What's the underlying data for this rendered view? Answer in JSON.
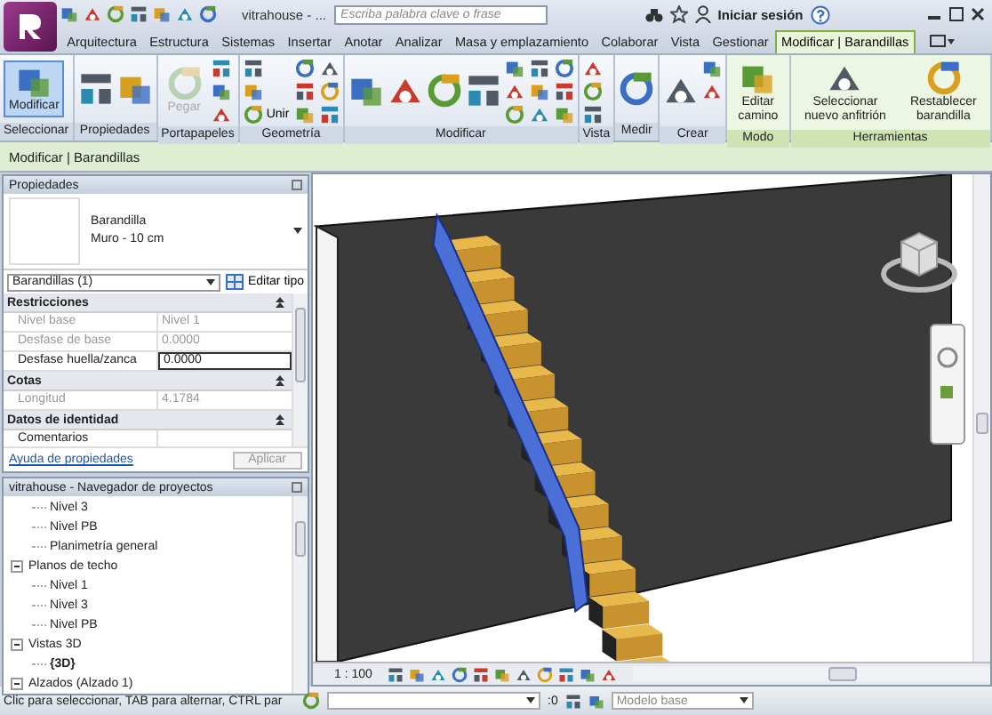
{
  "title_bar": {
    "title": "vitrahouse - ...",
    "search": {
      "placeholder": "Escriba palabra clave o frase"
    },
    "sign_in": "Iniciar sesión"
  },
  "tabs": [
    {
      "label": "Arquitectura",
      "selected": false
    },
    {
      "label": "Estructura",
      "selected": false
    },
    {
      "label": "Sistemas",
      "selected": false
    },
    {
      "label": "Insertar",
      "selected": false
    },
    {
      "label": "Anotar",
      "selected": false
    },
    {
      "label": "Analizar",
      "selected": false
    },
    {
      "label": "Masa y emplazamiento",
      "selected": false
    },
    {
      "label": "Colaborar",
      "selected": false
    },
    {
      "label": "Vista",
      "selected": false
    },
    {
      "label": "Gestionar",
      "selected": false
    },
    {
      "label": "Modificar | Barandillas",
      "selected": true
    }
  ],
  "ribbon": {
    "panels": [
      {
        "label": "Seleccionar",
        "tools": [
          {
            "kind": "large",
            "label": "Modificar",
            "active": true,
            "disabled": false
          }
        ]
      },
      {
        "label": "Propiedades",
        "tools": [
          {
            "kind": "large_icon"
          },
          {
            "kind": "large_icon"
          }
        ]
      },
      {
        "label": "Portapapeles",
        "tools": [
          {
            "kind": "large",
            "label": "Pegar",
            "active": false,
            "disabled": true
          },
          {
            "kind": "icon"
          },
          {
            "kind": "icon"
          },
          {
            "kind": "icon"
          }
        ]
      },
      {
        "label": "Geometría",
        "tools": [
          {
            "kind": "icon"
          },
          {
            "kind": "icon"
          },
          {
            "kind": "small",
            "label": "Unir"
          },
          {
            "kind": "icon"
          },
          {
            "kind": "icon"
          },
          {
            "kind": "icon"
          },
          {
            "kind": "icon"
          },
          {
            "kind": "icon"
          },
          {
            "kind": "icon"
          }
        ]
      },
      {
        "label": "Modificar",
        "tools": [
          {
            "kind": "large_icon"
          },
          {
            "kind": "large_icon"
          },
          {
            "kind": "large_icon"
          },
          {
            "kind": "large_icon"
          },
          {
            "kind": "icon"
          },
          {
            "kind": "icon"
          },
          {
            "kind": "icon"
          },
          {
            "kind": "icon"
          },
          {
            "kind": "icon"
          },
          {
            "kind": "icon"
          },
          {
            "kind": "icon"
          },
          {
            "kind": "icon"
          },
          {
            "kind": "icon"
          }
        ]
      },
      {
        "label": "Vista",
        "tools": [
          {
            "kind": "icon"
          },
          {
            "kind": "icon"
          },
          {
            "kind": "icon"
          }
        ]
      },
      {
        "label": "Medir",
        "tools": [
          {
            "kind": "large_icon"
          }
        ]
      },
      {
        "label": "Crear",
        "tools": [
          {
            "kind": "large_icon"
          },
          {
            "kind": "icon"
          },
          {
            "kind": "icon"
          }
        ]
      },
      {
        "label": "Modo",
        "tools": [
          {
            "kind": "large",
            "label": "Editar camino",
            "active": false,
            "disabled": false
          }
        ]
      },
      {
        "label": "Herramientas",
        "tools": [
          {
            "kind": "large",
            "label": "Seleccionar nuevo anfitrión",
            "active": false,
            "disabled": false
          },
          {
            "kind": "large",
            "label": "Restablecer barandilla",
            "active": false,
            "disabled": false
          }
        ]
      }
    ]
  },
  "options_bar": {
    "text": "Modificar | Barandillas"
  },
  "properties": {
    "title": "Propiedades",
    "type_name": "Barandilla",
    "type_detail": "Muro - 10 cm",
    "selector": "Barandillas (1)",
    "edit_type": "Editar tipo",
    "groups": [
      {
        "label": "Restricciones",
        "rows": [
          {
            "name": "Nivel base",
            "value": "Nivel 1",
            "disabled": true,
            "editing": false
          },
          {
            "name": "Desfase de base",
            "value": "0.0000",
            "disabled": true,
            "editing": false
          },
          {
            "name": "Desfase huella/zanca",
            "value": "0.0000",
            "disabled": false,
            "editing": true
          }
        ]
      },
      {
        "label": "Cotas",
        "rows": [
          {
            "name": "Longitud",
            "value": "4.1784",
            "disabled": true,
            "editing": false
          }
        ]
      },
      {
        "label": "Datos de identidad",
        "rows": [
          {
            "name": "Comentarios",
            "disabled": false,
            "editing": false
          }
        ]
      }
    ],
    "help_link": "Ayuda de propiedades",
    "apply": "Aplicar"
  },
  "browser": {
    "title": "vitrahouse - Navegador de proyectos",
    "tree": [
      {
        "children": [
          {
            "label": "Nivel 3",
            "selected": false
          },
          {
            "label": "Nivel PB",
            "selected": false
          },
          {
            "label": "Planimetría general",
            "selected": false
          }
        ]
      },
      {
        "label": "Planos de techo",
        "expanded": true,
        "selected": false,
        "children": [
          {
            "label": "Nivel 1",
            "selected": false
          },
          {
            "label": "Nivel 3",
            "selected": false
          },
          {
            "label": "Nivel PB",
            "selected": false
          }
        ]
      },
      {
        "label": "Vistas 3D",
        "expanded": true,
        "selected": false,
        "children": [
          {
            "label": "{3D}",
            "selected": true
          }
        ]
      },
      {
        "label": "Alzados (Alzado 1)",
        "expanded": true,
        "selected": false
      }
    ]
  },
  "view_bar": {
    "scale": "1 : 100"
  },
  "status_bar": {
    "text": "Clic para seleccionar, TAB para alternar, CTRL par",
    "filter": ":0",
    "workset": "Modelo base"
  }
}
